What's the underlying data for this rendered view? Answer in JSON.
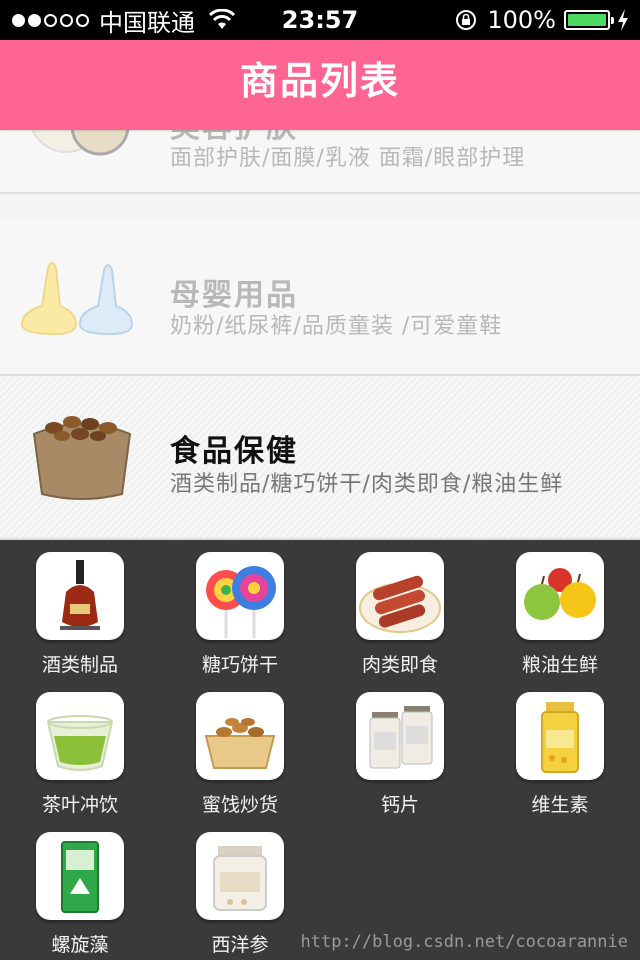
{
  "status_bar": {
    "carrier": "中国联通",
    "time": "23:57",
    "battery": "100%",
    "signal_bars_filled": 2,
    "signal_bars_total": 5
  },
  "nav": {
    "title": "商品列表"
  },
  "categories": [
    {
      "title": "美容护肤",
      "subtitle": "面部护肤/面膜/乳液 面霜/眼部护理",
      "icon": "cosmetics-icon",
      "state": "faded"
    },
    {
      "title": "母婴用品",
      "subtitle": "奶粉/纸尿裤/品质童装 /可爱童鞋",
      "icon": "baby-bottle-icon",
      "state": "faded"
    },
    {
      "title": "食品保健",
      "subtitle": "酒类制品/糖巧饼干/肉类即食/粮油生鲜",
      "icon": "nuts-sack-icon",
      "state": "selected"
    }
  ],
  "subcategories": [
    {
      "label": "酒类制品",
      "icon": "liquor-bottle-icon"
    },
    {
      "label": "糖巧饼干",
      "icon": "lollipop-icon"
    },
    {
      "label": "肉类即食",
      "icon": "sausage-plate-icon"
    },
    {
      "label": "粮油生鲜",
      "icon": "apples-icon"
    },
    {
      "label": "茶叶冲饮",
      "icon": "tea-cup-icon"
    },
    {
      "label": "蜜饯炒货",
      "icon": "nut-basket-icon"
    },
    {
      "label": "钙片",
      "icon": "supplement-bottles-icon"
    },
    {
      "label": "维生素",
      "icon": "vitamin-jar-icon"
    },
    {
      "label": "螺旋藻",
      "icon": "spirulina-box-icon"
    },
    {
      "label": "西洋参",
      "icon": "ginseng-jar-icon"
    }
  ],
  "watermark": "http://blog.csdn.net/cocoarannie",
  "colors": {
    "nav": "#fe6592",
    "panel": "#3a3a3a",
    "battery": "#4cd964"
  }
}
